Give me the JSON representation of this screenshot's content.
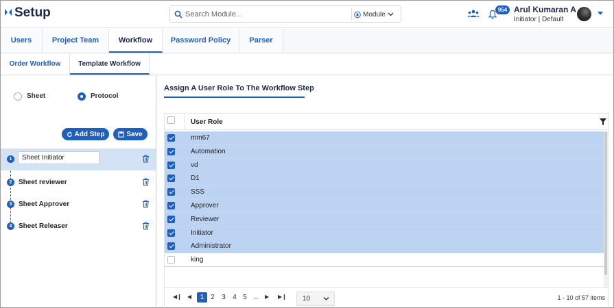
{
  "app": {
    "title": "Setup"
  },
  "search": {
    "placeholder": "Search Module...",
    "module_label": "Module"
  },
  "notifications": {
    "count": "954"
  },
  "user": {
    "name": "Arul Kumaran A",
    "role": "Initiator | Default"
  },
  "main_tabs": [
    {
      "label": "Users"
    },
    {
      "label": "Project Team"
    },
    {
      "label": "Workflow"
    },
    {
      "label": "Password Policy"
    },
    {
      "label": "Parser"
    }
  ],
  "sub_tabs": [
    {
      "label": "Order Workflow"
    },
    {
      "label": "Template Workflow"
    }
  ],
  "type_options": [
    {
      "label": "Sheet",
      "selected": false
    },
    {
      "label": "Protocol",
      "selected": true
    }
  ],
  "buttons": {
    "add_step": "Add Step",
    "save": "Save"
  },
  "steps": [
    {
      "number": "1",
      "label": "Sheet Initiator"
    },
    {
      "number": "2",
      "label": "Sheet reviewer"
    },
    {
      "number": "3",
      "label": "Sheet Approver"
    },
    {
      "number": "4",
      "label": "Sheet Releaser"
    }
  ],
  "section_title": "Assign A User Role To The Workflow Step",
  "grid": {
    "column_header": "User Role",
    "rows": [
      {
        "role": "mm67",
        "checked": true
      },
      {
        "role": "Automation",
        "checked": true
      },
      {
        "role": "vd",
        "checked": true
      },
      {
        "role": "D1",
        "checked": true
      },
      {
        "role": "SSS",
        "checked": true
      },
      {
        "role": "Approver",
        "checked": true
      },
      {
        "role": "Reviewer",
        "checked": true
      },
      {
        "role": "Initiator",
        "checked": true
      },
      {
        "role": "Administrator",
        "checked": true
      },
      {
        "role": "king",
        "checked": false
      }
    ]
  },
  "pager": {
    "pages": [
      "1",
      "2",
      "3",
      "4",
      "5",
      "..."
    ],
    "current_page": "1",
    "page_size": "10",
    "info": "1 - 10 of 57 items"
  },
  "colors": {
    "accent": "#1f5fbf",
    "selected_row": "#bdd3f2",
    "title": "#1b2a4a"
  }
}
